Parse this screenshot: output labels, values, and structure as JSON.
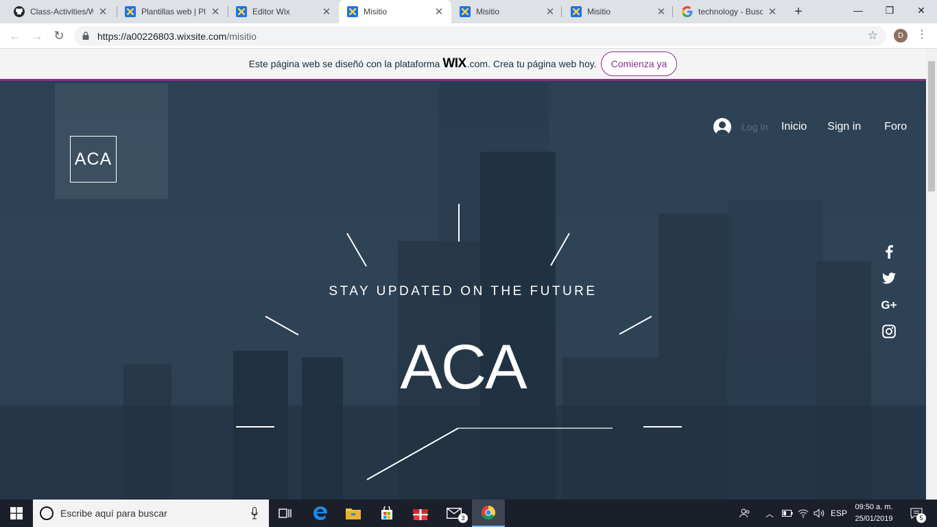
{
  "browser": {
    "tabs": [
      {
        "title": "Class-Activities/Wi",
        "icon": "github-icon",
        "active": false
      },
      {
        "title": "Plantillas web | Pla",
        "icon": "wix-icon",
        "active": false
      },
      {
        "title": "Editor Wix",
        "icon": "wix-icon",
        "active": false
      },
      {
        "title": "Misitio",
        "icon": "wix-icon",
        "active": true
      },
      {
        "title": "Misitio",
        "icon": "wix-icon",
        "active": false
      },
      {
        "title": "Misitio",
        "icon": "wix-icon",
        "active": false
      },
      {
        "title": "technology - Busca",
        "icon": "google-icon",
        "active": false
      }
    ],
    "url_host": "https://a00226803.wixsite.com",
    "url_path": "/misitio",
    "profile_initial": "D"
  },
  "banner": {
    "text_before": "Este página web se diseñó con la plataforma",
    "brand": "WIX",
    "text_after": ".com. Crea tu página web hoy.",
    "cta": "Comienza ya"
  },
  "site": {
    "logo": "ACA",
    "nav": {
      "login": "Log In",
      "links": [
        "Inicio",
        "Sign in",
        "Foro"
      ]
    },
    "tagline": "STAY UPDATED ON THE FUTURE",
    "title": "ACA",
    "social": [
      "facebook-icon",
      "twitter-icon",
      "google-plus-icon",
      "instagram-icon"
    ],
    "colors": {
      "overlay": "#2d4154",
      "accent": "#892e8c"
    }
  },
  "taskbar": {
    "search_placeholder": "Escribe aquí para buscar",
    "mail_badge": "3",
    "lang": "ESP",
    "time": "09:50 a. m.",
    "date": "25/01/2019",
    "notif_count": "5"
  }
}
